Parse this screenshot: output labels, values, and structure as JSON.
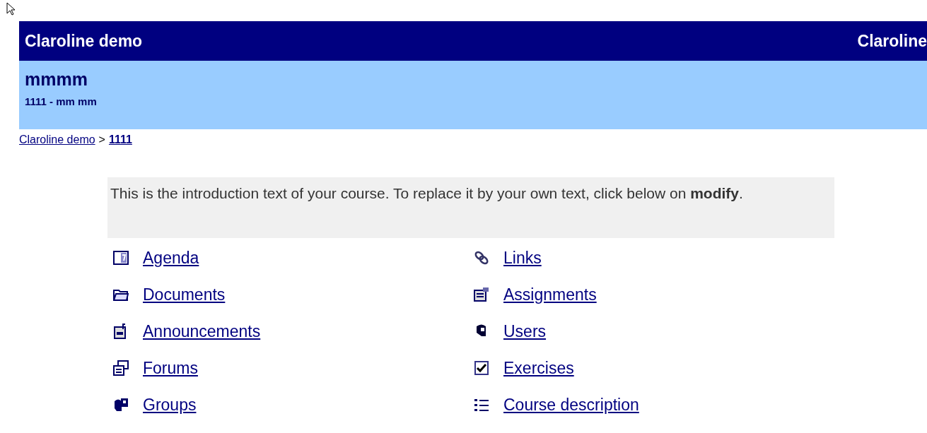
{
  "header": {
    "campus": "Claroline demo",
    "platform": "Claroline"
  },
  "course": {
    "title": "mmmm",
    "code_line": "1111 - mm mm"
  },
  "breadcrumb": [
    {
      "label": "Claroline demo",
      "current": false
    },
    {
      "separator": ">",
      "label": "1111",
      "current": true
    }
  ],
  "introduction": "This is the introduction text of your course. To replace it by your own text, click below on **modify**.",
  "tools": [
    {
      "label": "Agenda"
    },
    {
      "label": "Links"
    },
    {
      "label": "Documents"
    },
    {
      "label": "Assignments"
    },
    {
      "label": "Announcements"
    },
    {
      "label": "Users"
    },
    {
      "label": "Forums"
    },
    {
      "label": "Exercises"
    },
    {
      "label": "Groups"
    },
    {
      "label": "Course description"
    }
  ]
}
